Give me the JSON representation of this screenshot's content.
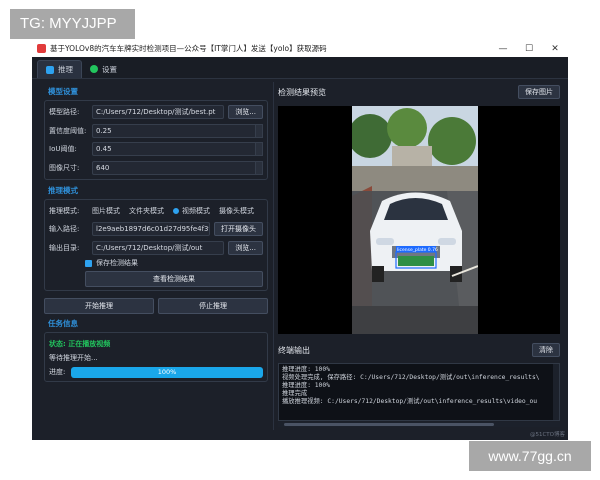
{
  "watermarks": {
    "top": "TG: MYYJJPP",
    "bottom": "www.77gg.cn",
    "corner": "@51CTO博客"
  },
  "window": {
    "title": "基于YOLOv8的汽车车牌实时检测项目—公众号【IT掌门人】发送【yolo】获取源码",
    "controls": [
      "—",
      "☐",
      "✕"
    ]
  },
  "tabs": [
    {
      "label": "推理",
      "active": true,
      "icon": "inference-tab-icon"
    },
    {
      "label": "设置",
      "active": false,
      "icon": "settings-tab-icon"
    }
  ],
  "model": {
    "section": "模型设置",
    "path_label": "模型路径:",
    "path_value": "C:/Users/712/Desktop/测试/best.pt",
    "browse": "浏览...",
    "conf_label": "置信度阈值:",
    "conf_value": "0.25",
    "iou_label": "IoU阈值:",
    "iou_value": "0.45",
    "size_label": "图像尺寸:",
    "size_value": "640"
  },
  "inference": {
    "section": "推理模式",
    "mode_label": "推理模式:",
    "modes": [
      "图片模式",
      "文件夹模式",
      "视频模式",
      "摄像头模式"
    ],
    "selected_mode": "视频模式",
    "input_label": "输入路径:",
    "input_value": "l2e9aeb1897d6c01d27d95fe4f3f5.mp4",
    "open_camera": "打开摄像头",
    "output_label": "输出目录:",
    "output_value": "C:/Users/712/Desktop/测试/out",
    "output_browse": "浏览...",
    "save_results": "保存检测结果",
    "save_checked": true,
    "view_results": "查看检测结果",
    "start": "开始推理",
    "stop": "停止推理"
  },
  "task": {
    "section": "任务信息",
    "status": "状态: 正在播放视频",
    "waiting": "等待推理开始...",
    "progress_label": "进度:",
    "progress_value": 1.0,
    "progress_text": "100%"
  },
  "preview": {
    "title": "检测结果预览",
    "save_button": "保存图片",
    "detection_label": "license_plate 0.76"
  },
  "terminal": {
    "title": "终端输出",
    "clear_button": "清除",
    "lines": [
      "推理进度: 100%",
      "视频处理完成, 保存路径: C:/Users/712/Desktop/测试/out\\inference_results\\",
      "推理进度: 100%",
      "推理完成",
      "播放推理视频: C:/Users/712/Desktop/测试/out\\inference_results\\video_ou"
    ]
  },
  "colors": {
    "accent": "#2ea2f0",
    "status_green": "#22c55e",
    "section_blue": "#2f8fd8",
    "detection_box": "#1e6bff"
  }
}
